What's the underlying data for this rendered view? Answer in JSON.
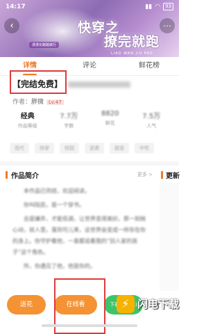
{
  "status": {
    "time": "14:17",
    "battery": "93"
  },
  "banner": {
    "title_line1": "快穿之",
    "title_line2": "撩完就跑",
    "pinyin": "LIAO WAN JIU PAO",
    "tagline": "漫漫长路踏歌行"
  },
  "tabs": [
    {
      "label": "详情"
    },
    {
      "label": "评论"
    },
    {
      "label": "鲜花榜"
    }
  ],
  "book": {
    "status_label": "【完结免费】",
    "author_prefix": "作者：",
    "author_name": "胖微",
    "author_badge": "Lv.47"
  },
  "stats": [
    {
      "value": "经典",
      "label": "作品等级"
    },
    {
      "value": "7.7万",
      "label": "字数"
    },
    {
      "value": "8820",
      "label": "鲜花"
    },
    {
      "value": "7.5万",
      "label": "人气"
    }
  ],
  "tags": [
    "现代",
    "快穿",
    "校园",
    "逆袭",
    "甜宠",
    "中性"
  ],
  "intro": {
    "title": "作品简介",
    "more": "更多 >",
    "paragraphs": [
      "本作品已完结，欢迎阅读。",
      "你叫陆凯，是一个穿书。",
      "总是嫌弃，才能低调，让世界变得美好。那一刻她心动，就人意。落到可儿来，这世界会变成一样存在你的身上。你守护着他，一直都追着我的“别人家的孩子”这个角色。",
      "所，你遇见了他，他是你的。"
    ]
  },
  "update": {
    "title": "更新"
  },
  "bottom": {
    "flower_label": "送花",
    "online_label": "在线看",
    "download_label": "下载(15MB)"
  },
  "watermark": {
    "text": "闪电下载"
  }
}
